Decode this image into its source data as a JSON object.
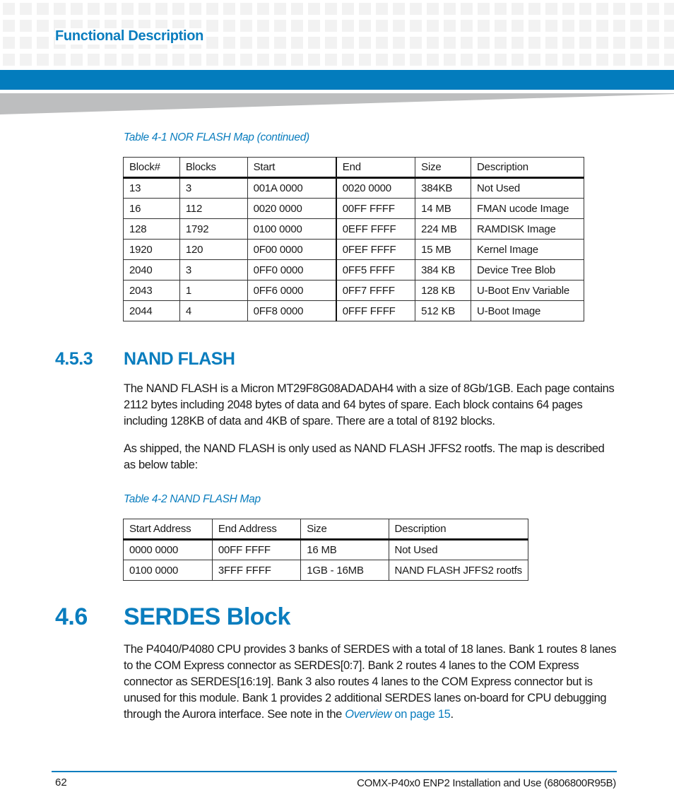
{
  "header": {
    "section_title": "Functional Description",
    "accent_color": "#037cbd"
  },
  "table_4_1": {
    "caption": "Table 4-1 NOR FLASH Map (continued)",
    "columns": [
      "Block#",
      "Blocks",
      "Start",
      "End",
      "Size",
      "Description"
    ],
    "rows": [
      [
        "13",
        "3",
        "001A 0000",
        "0020 0000",
        "384KB",
        "Not Used"
      ],
      [
        "16",
        "112",
        "0020 0000",
        "00FF FFFF",
        "14 MB",
        "FMAN ucode Image"
      ],
      [
        "128",
        "1792",
        "0100 0000",
        "0EFF FFFF",
        "224 MB",
        "RAMDISK Image"
      ],
      [
        "1920",
        "120",
        "0F00 0000",
        "0FEF FFFF",
        "15 MB",
        "Kernel Image"
      ],
      [
        "2040",
        "3",
        "0FF0 0000",
        "0FF5 FFFF",
        "384 KB",
        "Device Tree Blob"
      ],
      [
        "2043",
        "1",
        "0FF6 0000",
        "0FF7 FFFF",
        "128 KB",
        "U-Boot Env Variable"
      ],
      [
        "2044",
        "4",
        "0FF8 0000",
        "0FFF FFFF",
        "512 KB",
        "U-Boot Image"
      ]
    ]
  },
  "section_4_5_3": {
    "number": "4.5.3",
    "title": "NAND FLASH",
    "paragraphs": [
      "The NAND FLASH is a Micron MT29F8G08ADADAH4 with a size of 8Gb/1GB. Each page contains 2112 bytes including 2048 bytes of data and 64 bytes of spare. Each block contains 64 pages including 128KB of data and 4KB of spare. There are a total of 8192 blocks.",
      "As shipped, the NAND FLASH is only used as NAND FLASH JFFS2 rootfs. The map is described as below table:"
    ]
  },
  "table_4_2": {
    "caption": "Table 4-2 NAND FLASH Map",
    "columns": [
      "Start Address",
      "End Address",
      "Size",
      "Description"
    ],
    "rows": [
      [
        "0000 0000",
        "00FF FFFF",
        "16 MB",
        "Not Used"
      ],
      [
        "0100 0000",
        "3FFF FFFF",
        "1GB - 16MB",
        "NAND FLASH JFFS2 rootfs"
      ]
    ]
  },
  "section_4_6": {
    "number": "4.6",
    "title": "SERDES Block",
    "paragraph_text": "The P4040/P4080 CPU provides 3 banks of SERDES with a total of 18 lanes. Bank 1 routes 8 lanes to the COM Express connector as SERDES[0:7]. Bank 2 routes 4 lanes to the COM Express connector as SERDES[16:19]. Bank 3 also routes 4 lanes to the COM Express connector but is unused for this module. Bank 1 provides 2 additional SERDES lanes on-board for CPU debugging through the Aurora interface. See note in the ",
    "link_italic": "Overview",
    "link_page": " on page 15",
    "paragraph_end": "."
  },
  "footer": {
    "page_number": "62",
    "document_title": "COMX-P40x0 ENP2 Installation and Use (6806800R95B)"
  }
}
